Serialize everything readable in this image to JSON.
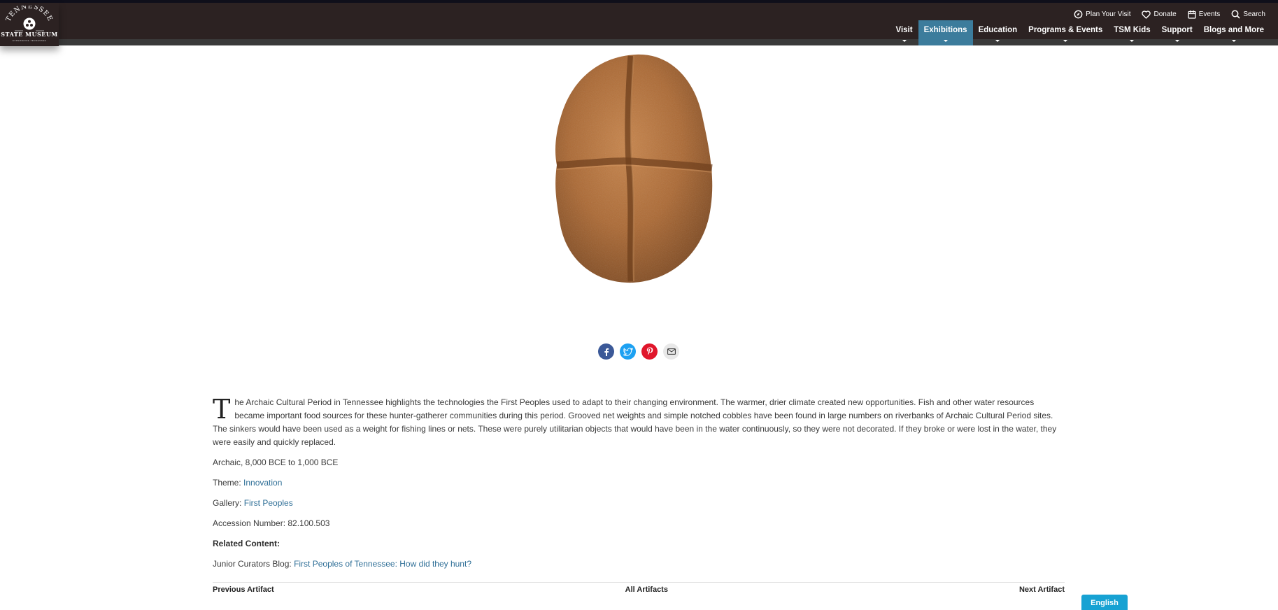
{
  "brand": {
    "arc_text": "TENNESSEE",
    "name": "STATE MUSEUM",
    "tagline": "EXPERIENCE TENNESSEE"
  },
  "utility_nav": [
    {
      "label": "Plan Your Visit",
      "icon": "compass-icon"
    },
    {
      "label": "Donate",
      "icon": "heart-icon"
    },
    {
      "label": "Events",
      "icon": "calendar-icon"
    },
    {
      "label": "Search",
      "icon": "search-icon"
    }
  ],
  "main_nav": [
    {
      "label": "Visit",
      "active": false
    },
    {
      "label": "Exhibitions",
      "active": true
    },
    {
      "label": "Education",
      "active": false
    },
    {
      "label": "Programs & Events",
      "active": false
    },
    {
      "label": "TSM Kids",
      "active": false
    },
    {
      "label": "Support",
      "active": false
    },
    {
      "label": "Blogs and More",
      "active": false
    }
  ],
  "share": [
    {
      "icon": "facebook-icon",
      "color": "#3b5998"
    },
    {
      "icon": "twitter-icon",
      "color": "#1da1f2"
    },
    {
      "icon": "pinterest-icon",
      "color": "#e0162b"
    },
    {
      "icon": "email-icon",
      "color": "#e8e8e8"
    }
  ],
  "article": {
    "drop_cap": "T",
    "intro_text": "he Archaic Cultural Period in Tennessee highlights the technologies the First Peoples used to adapt to their changing environment. The warmer, drier climate created new opportunities. Fish and other water resources became important food sources for these hunter-gatherer communities during this period. Grooved net weights and simple notched cobbles have been found in large numbers on riverbanks of Archaic Cultural Period sites. The sinkers would have been used as a weight for fishing lines or nets. These were purely utilitarian objects that would have been in the water continuously, so they were not decorated. If they broke or were lost in the water, they were easily and quickly replaced.",
    "period": "Archaic, 8,000 BCE to 1,000 BCE",
    "theme_label": "Theme:",
    "theme_value": "Innovation",
    "gallery_label": "Gallery:",
    "gallery_value": "First Peoples",
    "accession": "Accession Number: 82.100.503",
    "related_heading": "Related Content:",
    "related_prefix": "Junior Curators Blog:",
    "related_link": "First Peoples of Tennessee: How did they hunt?"
  },
  "pager": {
    "previous": "Previous Artifact",
    "all": "All Artifacts",
    "next": "Next Artifact"
  },
  "language_button": "English"
}
